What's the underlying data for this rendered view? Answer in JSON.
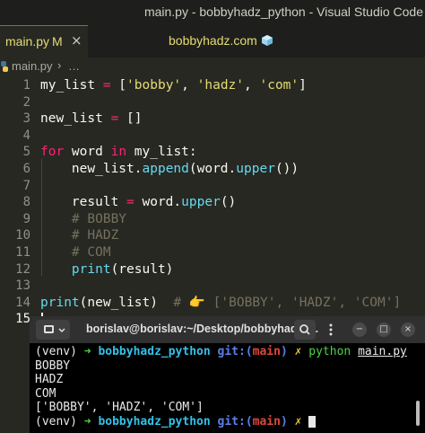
{
  "window": {
    "title": "main.py - bobbyhadz_python - Visual Studio Code"
  },
  "tab": {
    "label": "main.py",
    "modified": "M",
    "close": "×"
  },
  "header": {
    "center_title": "bobbyhadz.com"
  },
  "breadcrumb": {
    "file": "main.py",
    "sep": "›",
    "more": "…"
  },
  "gutter": [
    "1",
    "2",
    "3",
    "4",
    "5",
    "6",
    "7",
    "8",
    "9",
    "10",
    "11",
    "12",
    "13",
    "14",
    "15"
  ],
  "code": [
    [
      [
        "my_list ",
        ""
      ],
      [
        "=",
        "op"
      ],
      [
        " [",
        ""
      ],
      [
        "'bobby'",
        "str"
      ],
      [
        ", ",
        ""
      ],
      [
        "'hadz'",
        "str"
      ],
      [
        ", ",
        ""
      ],
      [
        "'com'",
        "str"
      ],
      [
        "]",
        ""
      ]
    ],
    [],
    [
      [
        "new_list ",
        ""
      ],
      [
        "=",
        "op"
      ],
      [
        " []",
        ""
      ]
    ],
    [],
    [
      [
        "for",
        "kw"
      ],
      [
        " word ",
        ""
      ],
      [
        "in",
        "kw"
      ],
      [
        " my_list:",
        ""
      ]
    ],
    [
      [
        "    new_list.",
        ""
      ],
      [
        "append",
        "fn"
      ],
      [
        "(word.",
        ""
      ],
      [
        "upper",
        "fn"
      ],
      [
        "())",
        ""
      ]
    ],
    [],
    [
      [
        "    result ",
        ""
      ],
      [
        "=",
        "op"
      ],
      [
        " word.",
        ""
      ],
      [
        "upper",
        "fn"
      ],
      [
        "()",
        ""
      ]
    ],
    [
      [
        "    # BOBBY",
        "cm"
      ]
    ],
    [
      [
        "    # HADZ",
        "cm"
      ]
    ],
    [
      [
        "    # COM",
        "cm"
      ]
    ],
    [
      [
        "    ",
        ""
      ],
      [
        "print",
        "fn"
      ],
      [
        "(result)",
        ""
      ]
    ],
    [],
    [
      [
        "print",
        "fn"
      ],
      [
        "(new_list)  ",
        ""
      ],
      [
        "# 👉 ['BOBBY', 'HADZ', 'COM']",
        "cm"
      ]
    ],
    []
  ],
  "terminal": {
    "title": "borislav@borislav:~/Desktop/bobbyhadz_...",
    "prompt": {
      "venv": "(venv) ",
      "arrow": "➜",
      "dir": "bobbyhadz_python",
      "git": "git:(",
      "branch": "main",
      "git_close": ")",
      "dirty": "✗"
    },
    "command": "python",
    "argument": "main.py",
    "output": [
      "BOBBY",
      "HADZ",
      "COM",
      "['BOBBY', 'HADZ', 'COM']"
    ],
    "controls": {
      "minimize": "−",
      "maximize": "□",
      "close": "×"
    }
  },
  "colors": {
    "background": "#272822",
    "keyword": "#f92672",
    "string": "#e6db74",
    "function": "#66d9ef",
    "comment": "#75715e"
  }
}
